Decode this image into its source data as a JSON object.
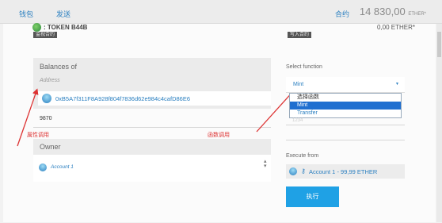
{
  "nav": {
    "wallet": "钱包",
    "send": "发送",
    "contract": "合约"
  },
  "balance": {
    "amount": "14 830,00",
    "unit": "ETHER*"
  },
  "token": {
    "name": ": TOKEN B44B",
    "balance": "0,00 ETHER*",
    "stamp_left": "监视合约",
    "stamp_right": "写入合约"
  },
  "left_panel": {
    "title": "Balances of",
    "address_label": "Address",
    "address_value": "0xB5A7f311F8A928f804f7836d62e984c4cafD86E6",
    "result": "9870",
    "owner_title": "Owner",
    "owner_account": "Account 1"
  },
  "annotations": {
    "property_call": "属性调用",
    "function_call": "函数调用"
  },
  "right_panel": {
    "select_label": "Select function",
    "selected": "Mint",
    "options": [
      "选择函数",
      "Mint",
      "Transfer"
    ],
    "faded_value": "1234",
    "execute_from_label": "Execute from",
    "execute_account": "Account 1 - 99,99 ETHER",
    "execute_button": "执行"
  },
  "colors": {
    "accent": "#1fa1e5",
    "link": "#2a7fc0",
    "annotation": "#dd3333"
  }
}
